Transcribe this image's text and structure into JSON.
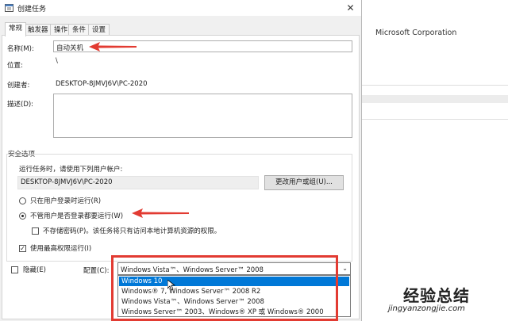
{
  "background": {
    "company": "Microsoft Corporation"
  },
  "dialog": {
    "title": "创建任务",
    "close_symbol": "✕",
    "tabs": [
      "常规",
      "触发器",
      "操作",
      "条件",
      "设置"
    ],
    "name_label": "名称(M):",
    "name_value": "自动关机",
    "location_label": "位置:",
    "location_value": "\\",
    "author_label": "创建者:",
    "author_value": "DESKTOP-8JMVJ6V\\PC-2020",
    "description_label": "描述(D):",
    "security": {
      "group_label": "安全选项",
      "run_as_text": "运行任务时，请使用下列用户帐户:",
      "account": "DESKTOP-8JMVJ6V\\PC-2020",
      "change_button": "更改用户或组(U)...",
      "radio_logged_on": "只在用户登录时运行(R)",
      "radio_whether": "不管用户是否登录都要运行(W)",
      "no_store_password": "不存储密码(P)。该任务将只有访问本地计算机资源的权限。",
      "highest_privileges": "使用最高权限运行(I)"
    },
    "hidden_label": "隐藏(E)",
    "configure_label": "配置(C):",
    "configure_value": "Windows Vista™、Windows Server™ 2008",
    "options": [
      "Windows 10",
      "Windows® 7, Windows Server™ 2008 R2",
      "Windows Vista™、Windows Server™ 2008",
      "Windows Server™ 2003、Windows® XP 或 Windows® 2000"
    ],
    "selected_option_index": 0
  },
  "watermark": {
    "logo_text": "经验总结",
    "url": "jingyanzongjie.com"
  },
  "colors": {
    "highlight": "#e23b32",
    "selection": "#0078d7"
  }
}
